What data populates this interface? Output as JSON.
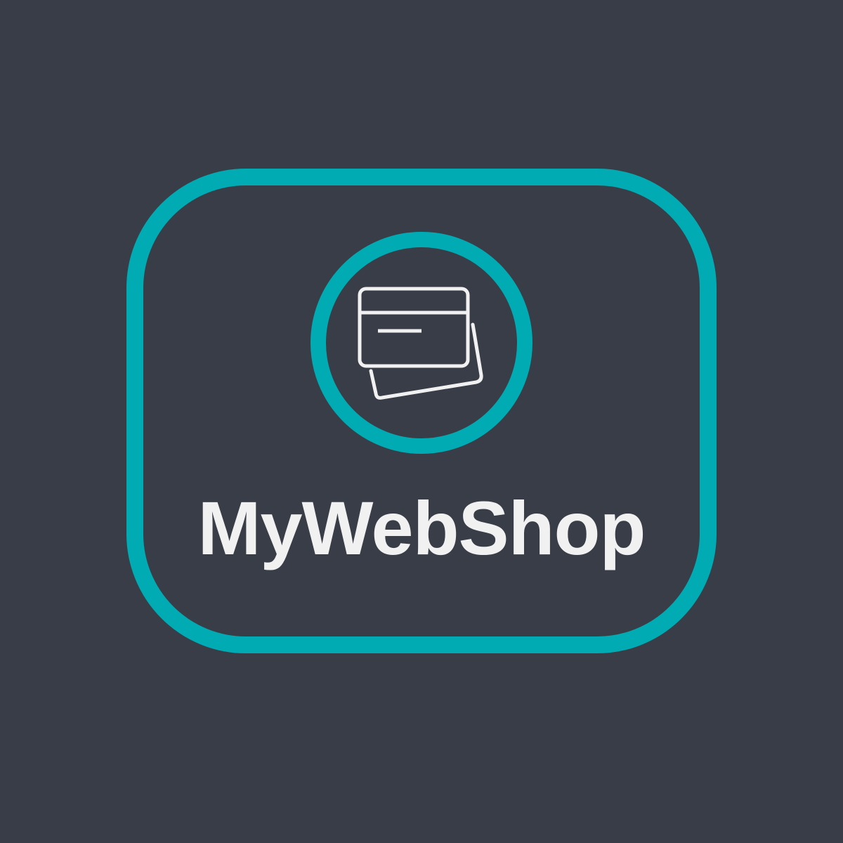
{
  "logo": {
    "brand_name": "MyWebShop",
    "icon": "credit-card-icon",
    "colors": {
      "background": "#393d47",
      "accent": "#00abb3",
      "foreground": "#f1f1f1"
    }
  }
}
